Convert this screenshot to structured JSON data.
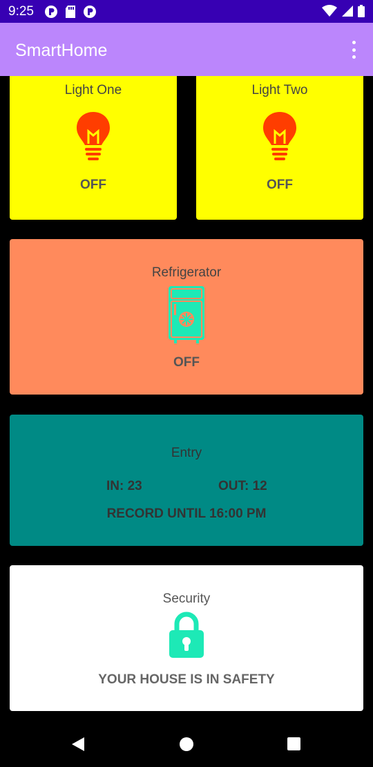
{
  "status_bar": {
    "time": "9:25",
    "icons_left": [
      "p-badge-icon",
      "sd-card-icon",
      "p-badge-icon"
    ],
    "icons_right": [
      "wifi-icon",
      "signal-icon",
      "battery-icon"
    ],
    "background": "#3700b3"
  },
  "app_bar": {
    "title": "SmartHome",
    "background": "#bb86fc",
    "menu_icon": "overflow-menu-icon"
  },
  "cards": {
    "light_one": {
      "title": "Light One",
      "state": "OFF",
      "icon": "lightbulb-icon",
      "background": "#ffff00",
      "icon_color": "#ff3d00"
    },
    "light_two": {
      "title": "Light Two",
      "state": "OFF",
      "icon": "lightbulb-icon",
      "background": "#ffff00",
      "icon_color": "#ff3d00"
    },
    "refrigerator": {
      "title": "Refrigerator",
      "state": "OFF",
      "icon": "refrigerator-icon",
      "background": "#ff8a5c",
      "icon_color": "#1de9b6"
    },
    "entry": {
      "title": "Entry",
      "in_label": "IN: 23",
      "out_label": "OUT: 12",
      "record": "RECORD UNTIL 16:00 PM",
      "background": "#008a85"
    },
    "security": {
      "title": "Security",
      "message": "YOUR HOUSE IS IN SAFETY",
      "icon": "lock-icon",
      "background": "#ffffff",
      "icon_color": "#1de9b6"
    }
  },
  "nav_bar": {
    "buttons": [
      "back-icon",
      "home-icon",
      "recents-icon"
    ]
  }
}
